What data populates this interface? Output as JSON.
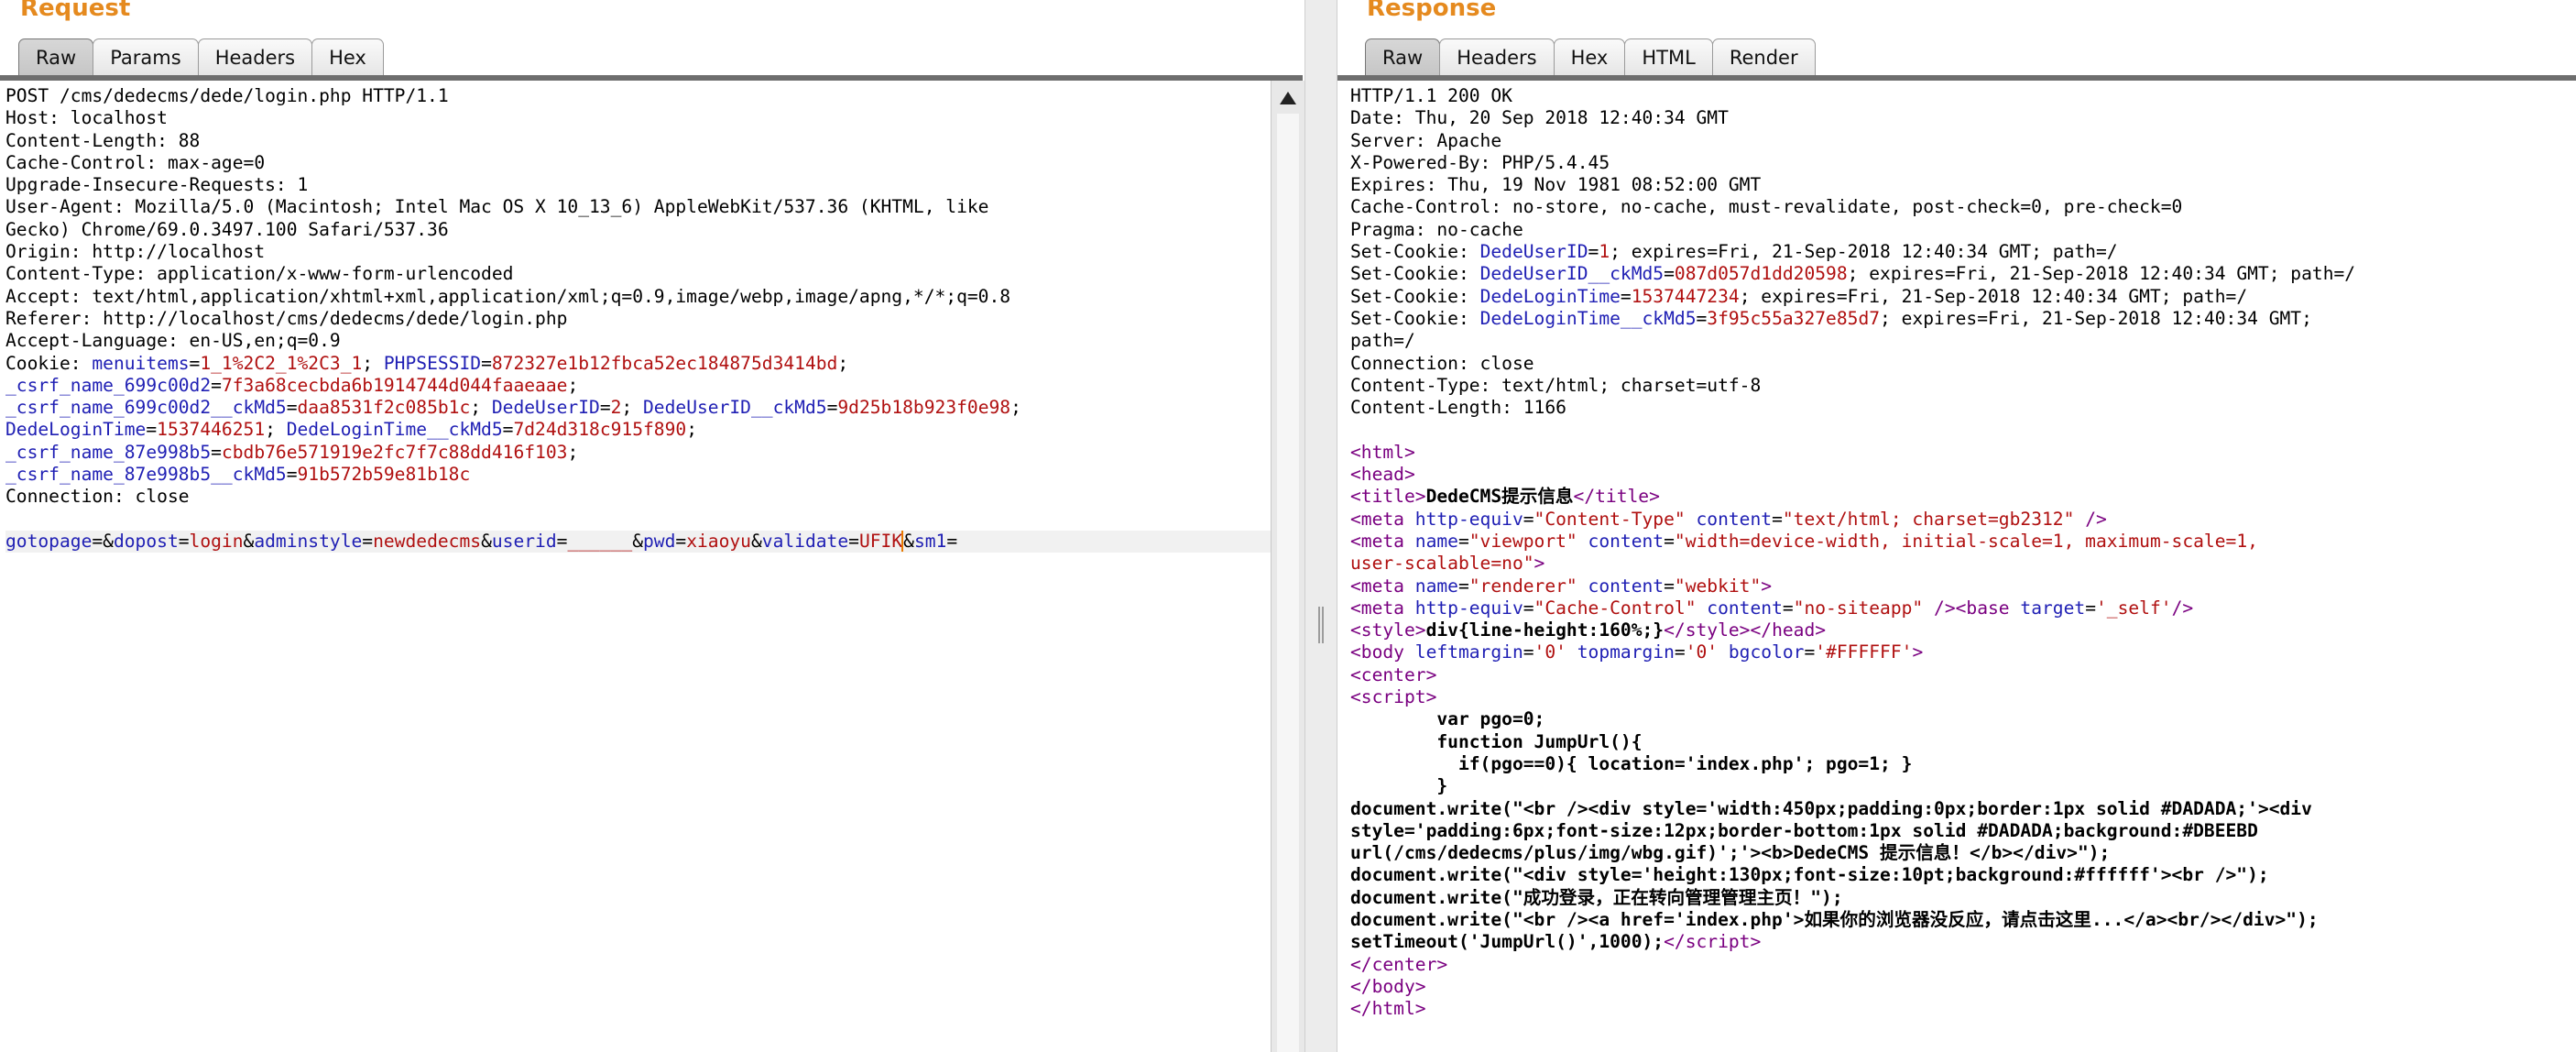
{
  "request": {
    "title": "Request",
    "tabs": [
      "Raw",
      "Params",
      "Headers",
      "Hex"
    ],
    "active_tab": "Raw",
    "lines": {
      "l1": "POST /cms/dedecms/dede/login.php HTTP/1.1",
      "l2": "Host: localhost",
      "l3": "Content-Length: 88",
      "l4": "Cache-Control: max-age=0",
      "l5": "Upgrade-Insecure-Requests: 1",
      "l6": "User-Agent: Mozilla/5.0 (Macintosh; Intel Mac OS X 10_13_6) AppleWebKit/537.36 (KHTML, like",
      "l7": "Gecko) Chrome/69.0.3497.100 Safari/537.36",
      "l8": "Origin: http://localhost",
      "l9": "Content-Type: application/x-www-form-urlencoded",
      "l10": "Accept: text/html,application/xhtml+xml,application/xml;q=0.9,image/webp,image/apng,*/*;q=0.8",
      "l11": "Referer: http://localhost/cms/dedecms/dede/login.php",
      "l12": "Accept-Language: en-US,en;q=0.9",
      "l18": "Connection: close"
    },
    "cookie": {
      "prefix": "Cookie: ",
      "menuitems_k": "menuitems",
      "menuitems_v": "1_1%2C2_1%2C3_1",
      "phpsessid_k": "PHPSESSID",
      "phpsessid_v": "872327e1b12fbca52ec184875d3414bd",
      "csrf1_k": "_csrf_name_699c00d2",
      "csrf1_v": "7f3a68cecbda6b1914744d044faaeaae",
      "csrf1md5_k": "_csrf_name_699c00d2__ckMd5",
      "csrf1md5_v": "daa8531f2c085b1c",
      "uid_k": "DedeUserID",
      "uid_v": "2",
      "uidmd5_k": "DedeUserID__ckMd5",
      "uidmd5_v": "9d25b18b923f0e98",
      "lt_k": "DedeLoginTime",
      "lt_v": "1537446251",
      "ltmd5_k": "DedeLoginTime__ckMd5",
      "ltmd5_v": "7d24d318c915f890",
      "csrf2_k": "_csrf_name_87e998b5",
      "csrf2_v": "cbdb76e571919e2fc7f7c88dd416f103",
      "csrf2md5_k": "_csrf_name_87e998b5__ckMd5",
      "csrf2md5_v": "91b572b59e81b18c"
    },
    "body": {
      "gotopage_k": "gotopage",
      "gotopage_v": "",
      "dopost_k": "dopost",
      "dopost_v": "login",
      "adminstyle_k": "adminstyle",
      "adminstyle_v": "newdedecms",
      "userid_k": "userid",
      "userid_v": "______",
      "pwd_k": "pwd",
      "pwd_v": "xiaoyu",
      "validate_k": "validate",
      "validate_v": "UFIK",
      "sm1_k": "sm1",
      "sm1_v": ""
    }
  },
  "response": {
    "title": "Response",
    "tabs": [
      "Raw",
      "Headers",
      "Hex",
      "HTML",
      "Render"
    ],
    "active_tab": "Raw",
    "headers": {
      "h1": "HTTP/1.1 200 OK",
      "h2": "Date: Thu, 20 Sep 2018 12:40:34 GMT",
      "h3": "Server: Apache",
      "h4": "X-Powered-By: PHP/5.4.45",
      "h5": "Expires: Thu, 19 Nov 1981 08:52:00 GMT",
      "h6": "Cache-Control: no-store, no-cache, must-revalidate, post-check=0, pre-check=0",
      "h7": "Pragma: no-cache",
      "h14": "Connection: close",
      "h15": "Content-Type: text/html; charset=utf-8",
      "h16": "Content-Length: 1166"
    },
    "set_cookies": {
      "label": "Set-Cookie: ",
      "c1_k": "DedeUserID",
      "c1_v": "1",
      "c1_rest": "; expires=Fri, 21-Sep-2018 12:40:34 GMT; path=/",
      "c2_k": "DedeUserID__ckMd5",
      "c2_v": "087d057d1dd20598",
      "c2_rest": "; expires=Fri, 21-Sep-2018 12:40:34 GMT; path=/",
      "c3_k": "DedeLoginTime",
      "c3_v": "1537447234",
      "c3_rest": "; expires=Fri, 21-Sep-2018 12:40:34 GMT; path=/",
      "c4_k": "DedeLoginTime__ckMd5",
      "c4_v": "3f95c55a327e85d7",
      "c4_rest": "; expires=Fri, 21-Sep-2018 12:40:34 GMT;",
      "c4_wrap": "path=/"
    },
    "html": {
      "title_text": "DedeCMS提示信息",
      "meta1_content": "\"text/html; charset=gb2312\"",
      "meta2_content_a": "\"width=device-width, initial-scale=1, maximum-scale=1,",
      "meta2_content_b": "user-scalable=no\"",
      "meta3_content": "\"webkit\"",
      "meta4_content": "\"no-siteapp\"",
      "base_target": "'_self'",
      "style_text": "div{line-height:160%;}",
      "body_lm": "'0'",
      "body_tm": "'0'",
      "body_bg": "'#FFFFFF'",
      "js1": "        var pgo=0;",
      "js2": "        function JumpUrl(){",
      "js3": "          if(pgo==0){ location='index.php'; pgo=1; }",
      "js4": "        }",
      "js5": "document.write(\"<br /><div style='width:450px;padding:0px;border:1px solid #DADADA;'><div",
      "js6": "style='padding:6px;font-size:12px;border-bottom:1px solid #DADADA;background:#DBEEBD",
      "js7": "url(/cms/dedecms/plus/img/wbg.gif)';'><b>DedeCMS 提示信息！</b></div>\");",
      "js8": "document.write(\"<div style='height:130px;font-size:10pt;background:#ffffff'><br />\");",
      "js9": "document.write(\"成功登录，正在转向管理管理主页！\");",
      "js10": "document.write(\"<br /><a href='index.php'>如果你的浏览器没反应，请点击这里...</a><br/></div>\");",
      "js11": "setTimeout('JumpUrl()',1000);"
    }
  },
  "colors": {
    "title": "#e58a1f",
    "key": "#1f1fb4",
    "value": "#b01010",
    "tag": "#7a0080"
  },
  "icons": {
    "scroll_up": "triangle-up"
  }
}
